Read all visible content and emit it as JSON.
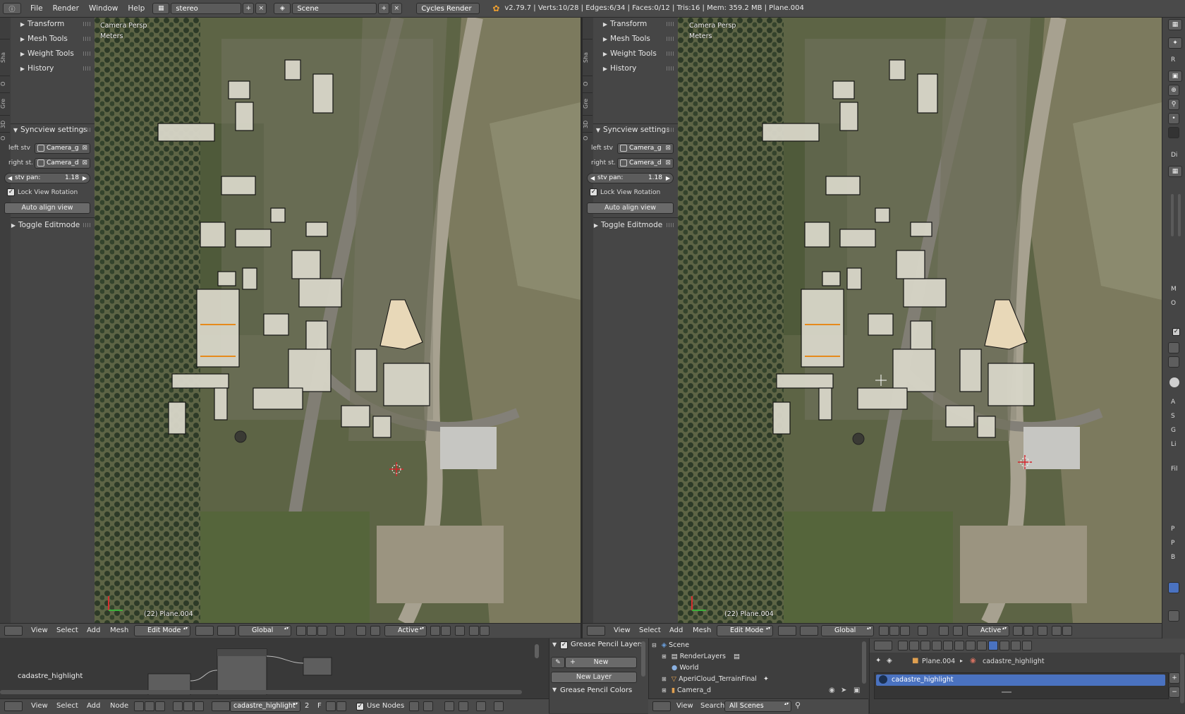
{
  "topbar": {
    "menus": [
      "File",
      "Render",
      "Window",
      "Help"
    ],
    "screen_layout": "stereo",
    "scene": "Scene",
    "render_engine": "Cycles Render",
    "stats": "v2.79.7 | Verts:10/28 | Edges:6/34 | Faces:0/12 | Tris:16 | Mem: 359.2 MB | Plane.004"
  },
  "left_view": {
    "tabs": [
      "Sha",
      "O",
      "Gre",
      "3D",
      "O"
    ],
    "panels": {
      "transform": "Transform",
      "mesh_tools": "Mesh Tools",
      "weight_tools": "Weight Tools",
      "history": "History",
      "syncview": "Syncview settings",
      "toggle_editmode": "Toggle Editmode"
    },
    "left_stv_label": "left stv ..",
    "left_stv_value": "Camera_g",
    "right_stv_label": "right st...",
    "right_stv_value": "Camera_d",
    "stv_pan_label": "stv pan:",
    "stv_pan_value": "1.18",
    "lock_view_rotation": "Lock View Rotation",
    "auto_align": "Auto align view",
    "view_name": "Camera Persp",
    "units": "Meters",
    "object_label": "(22) Plane.004"
  },
  "right_view": {
    "tabs": [
      "Sha",
      "O",
      "Gre",
      "3D",
      "O"
    ],
    "panels": {
      "transform": "Transform",
      "mesh_tools": "Mesh Tools",
      "weight_tools": "Weight Tools",
      "history": "History",
      "syncview": "Syncview settings",
      "toggle_editmode": "Toggle Editmode"
    },
    "left_stv_label": "left stv ..",
    "left_stv_value": "Camera_g",
    "right_stv_label": "right st...",
    "right_stv_value": "Camera_d",
    "stv_pan_label": "stv pan:",
    "stv_pan_value": "1.18",
    "lock_view_rotation": "Lock View Rotation",
    "auto_align": "Auto align view",
    "view_name": "Camera Persp",
    "units": "Meters",
    "object_label": "(22) Plane.004"
  },
  "view_header": {
    "menus": [
      "View",
      "Select",
      "Add",
      "Mesh"
    ],
    "mode": "Edit Mode",
    "orientation": "Global",
    "pivot": "Active"
  },
  "node_editor": {
    "material_label": "cadastre_highlight",
    "header_menus": [
      "View",
      "Select",
      "Add",
      "Node"
    ],
    "material_field": "cadastre_highlight",
    "users": "2",
    "fake_user": "F",
    "use_nodes": "Use Nodes"
  },
  "grease_pencil": {
    "layers_title": "Grease Pencil Layers",
    "new_button": "New",
    "new_layer_button": "New Layer",
    "colors_title": "Grease Pencil Colors"
  },
  "outliner": {
    "rows": [
      "Scene",
      "RenderLayers",
      "World",
      "AperiCloud_TerrainFinal",
      "Camera_d"
    ],
    "header_menus": [
      "View",
      "Search"
    ],
    "filter": "All Scenes"
  },
  "properties": {
    "breadcrumb_object": "Plane.004",
    "breadcrumb_material": "cadastre_highlight",
    "material_slot": "cadastre_highlight"
  },
  "right_toolbar_labels": [
    "R",
    "Di",
    "M",
    "O",
    "Fil",
    "P",
    "P",
    "B",
    "A",
    "S",
    "G",
    "Li"
  ],
  "colors": {
    "ui_bg": "#464646",
    "header_bg": "#4a4a4a",
    "selection_blue": "#4a72c0",
    "orange_highlight": "#e68a1c"
  }
}
